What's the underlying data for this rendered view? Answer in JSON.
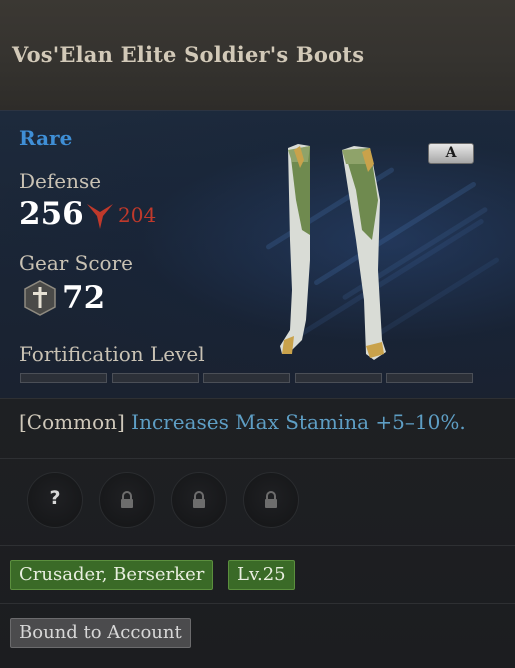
{
  "item": {
    "name": "Vos'Elan Elite Soldier's Boots",
    "rarity": "Rare",
    "grade": "A"
  },
  "stats": {
    "defense_label": "Defense",
    "defense_value": "256",
    "defense_compare": "204",
    "gear_score_label": "Gear Score",
    "gear_score_value": "72",
    "fortification_label": "Fortification Level",
    "fortification_segments_filled": 0,
    "fortification_segments_total": 5
  },
  "effect": {
    "tag": "[Common]",
    "text": "Increases Max Stamina +5–10%."
  },
  "sockets": [
    {
      "state": "unknown",
      "symbol": "?"
    },
    {
      "state": "locked"
    },
    {
      "state": "locked"
    },
    {
      "state": "locked"
    }
  ],
  "requirements": {
    "classes": "Crusader, Berserker",
    "level": "Lv.25"
  },
  "binding": "Bound to Account",
  "colors": {
    "rarity_rare": "#3f8fd6",
    "stat_decrease": "#c0392b",
    "effect_text": "#5e9ec4",
    "requirement_tag": "#3a6a27"
  },
  "icons": {
    "compare_arrow": "down-arrow-icon",
    "gear_score": "gear-score-sword-icon",
    "socket_locked": "lock-icon"
  }
}
